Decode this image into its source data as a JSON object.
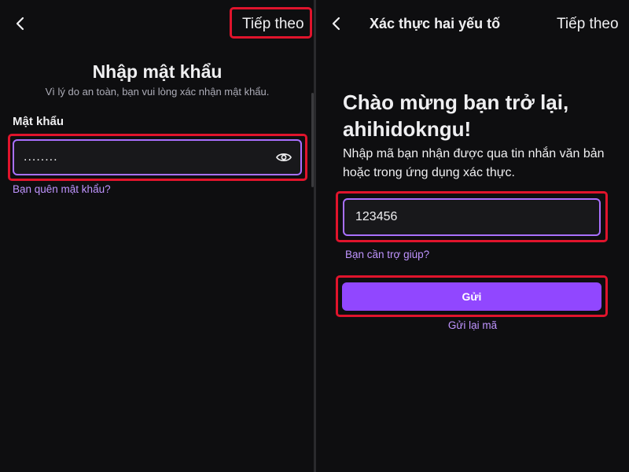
{
  "left": {
    "next_label": "Tiếp theo",
    "title": "Nhập mật khẩu",
    "subtitle": "Vì lý do an toàn, bạn vui lòng xác nhận mật khẩu.",
    "password_label": "Mật khẩu",
    "password_value": "........",
    "forgot_link": "Bạn quên mật khẩu?"
  },
  "right": {
    "header_title": "Xác thực hai yếu tố",
    "next_label": "Tiếp theo",
    "welcome_line1": "Chào mừng bạn trở lại,",
    "welcome_line2": "ahihidokngu!",
    "description": "Nhập mã bạn nhận được qua tin nhắn văn bản hoặc trong ứng dụng xác thực.",
    "code_value": "123456",
    "help_link": "Bạn cần trợ giúp?",
    "submit_label": "Gửi",
    "resend_link": "Gửi lại mã"
  },
  "colors": {
    "background": "#0e0e10",
    "accent": "#9147ff",
    "link": "#bf94ff",
    "highlight": "#e0142c"
  }
}
